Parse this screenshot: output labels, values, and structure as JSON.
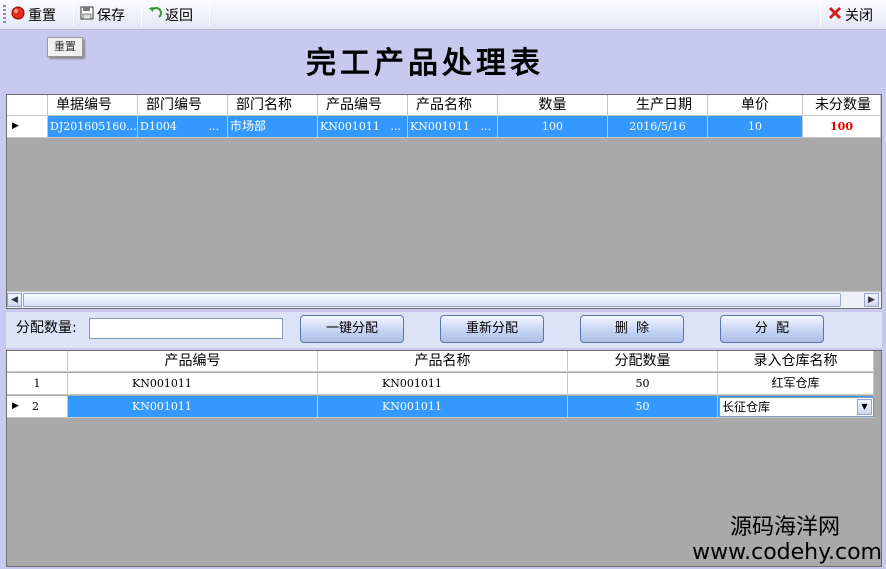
{
  "toolbar": {
    "reset_label": "重置",
    "save_label": "保存",
    "back_label": "返回",
    "close_label": "关闭"
  },
  "tooltip": "重置",
  "title": "完工产品处理表",
  "top_grid": {
    "columns": [
      "单据编号",
      "部门编号",
      "部门名称",
      "产品编号",
      "产品名称",
      "数量",
      "生产日期",
      "单价",
      "未分数量"
    ],
    "rows": [
      {
        "doc_no": "DJ201605160...",
        "dept_no": "D1004",
        "dept_no_more": "...",
        "dept_name": "市场部",
        "product_no": "KN001011",
        "product_no_more": "...",
        "product_name": "KN001011",
        "product_name_more": "...",
        "quantity": "100",
        "date": "2016/5/16",
        "price": "10",
        "unassigned": "100"
      }
    ]
  },
  "distribution": {
    "label": "分配数量:",
    "value": "",
    "one_click_label": "一键分配",
    "reassign_label": "重新分配",
    "delete_label": "删  除",
    "assign_label": "分  配"
  },
  "bottom_grid": {
    "columns": [
      "产品编号",
      "产品名称",
      "分配数量",
      "录入仓库名称"
    ],
    "rows": [
      {
        "index": "1",
        "product_no": "KN001011",
        "product_name": "KN001011",
        "qty": "50",
        "warehouse": "红军仓库"
      },
      {
        "index": "2",
        "product_no": "KN001011",
        "product_name": "KN001011",
        "qty": "50",
        "warehouse": "长征仓库"
      }
    ]
  },
  "watermark": {
    "line1": "源码海洋网",
    "line2": "www.codehy.com"
  },
  "colors": {
    "selection": "#3399ff",
    "background": "#c9c9f0",
    "unassigned_value": "#e00000"
  }
}
